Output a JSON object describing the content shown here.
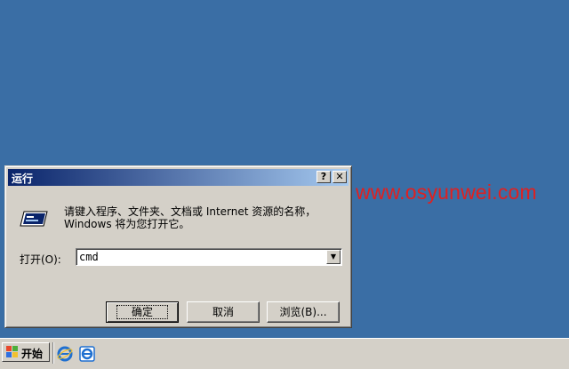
{
  "watermark": "www.osyunwei.com",
  "dialog": {
    "title": "运行",
    "help_glyph": "?",
    "close_glyph": "✕",
    "description": "请键入程序、文件夹、文档或 Internet 资源的名称，Windows 将为您打开它。",
    "open_label": "打开(O):",
    "open_value": "cmd",
    "dropdown_glyph": "▼",
    "ok_label": "确定",
    "cancel_label": "取消",
    "browse_label": "浏览(B)..."
  },
  "taskbar": {
    "start_label": "开始",
    "quick_launch": [
      "ie-icon",
      "ie-browser-icon"
    ]
  },
  "colors": {
    "desktop": "#3a6ea5",
    "title_start": "#0a246a",
    "title_end": "#a6caf0",
    "watermark": "#e02020"
  }
}
